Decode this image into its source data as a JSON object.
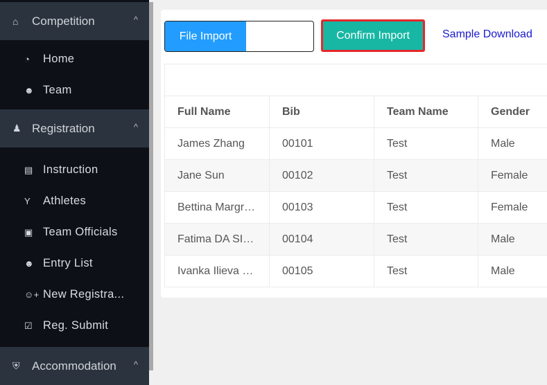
{
  "sidebar": {
    "groups": [
      {
        "label": "Competition",
        "icon": "home-icon",
        "items": [
          {
            "label": "Home",
            "icon": "dashboard-icon"
          },
          {
            "label": "Team",
            "icon": "users-icon"
          }
        ]
      },
      {
        "label": "Registration",
        "icon": "person-icon",
        "items": [
          {
            "label": "Instruction",
            "icon": "book-icon"
          },
          {
            "label": "Athletes",
            "icon": "athlete-icon"
          },
          {
            "label": "Team Officials",
            "icon": "contact-card-icon"
          },
          {
            "label": "Entry List",
            "icon": "users-icon"
          },
          {
            "label": "New Registra...",
            "icon": "user-plus-icon"
          },
          {
            "label": "Reg. Submit",
            "icon": "check-square-icon"
          }
        ]
      },
      {
        "label": "Accommodation",
        "icon": "bank-icon",
        "items": []
      }
    ]
  },
  "toolbar": {
    "file_import": "File Import",
    "confirm_import": "Confirm Import",
    "sample_download": "Sample Download"
  },
  "table": {
    "headers": [
      "Full Name",
      "Bib",
      "Team Name",
      "Gender"
    ],
    "rows": [
      [
        "James Zhang",
        "00101",
        "Test",
        "Male"
      ],
      [
        "Jane Sun",
        "00102",
        "Test",
        "Female"
      ],
      [
        "Bettina Margr…",
        "00103",
        "Test",
        "Female"
      ],
      [
        "Fatima DA SI…",
        "00104",
        "Test",
        "Male"
      ],
      [
        "Ivanka Ilieva …",
        "00105",
        "Test",
        "Male"
      ]
    ]
  },
  "colors": {
    "primary": "#229dff",
    "confirm": "#17b7a4",
    "highlight": "#e8262a",
    "sidebar": "#0d1016",
    "sidebar_group": "#2b333e"
  }
}
